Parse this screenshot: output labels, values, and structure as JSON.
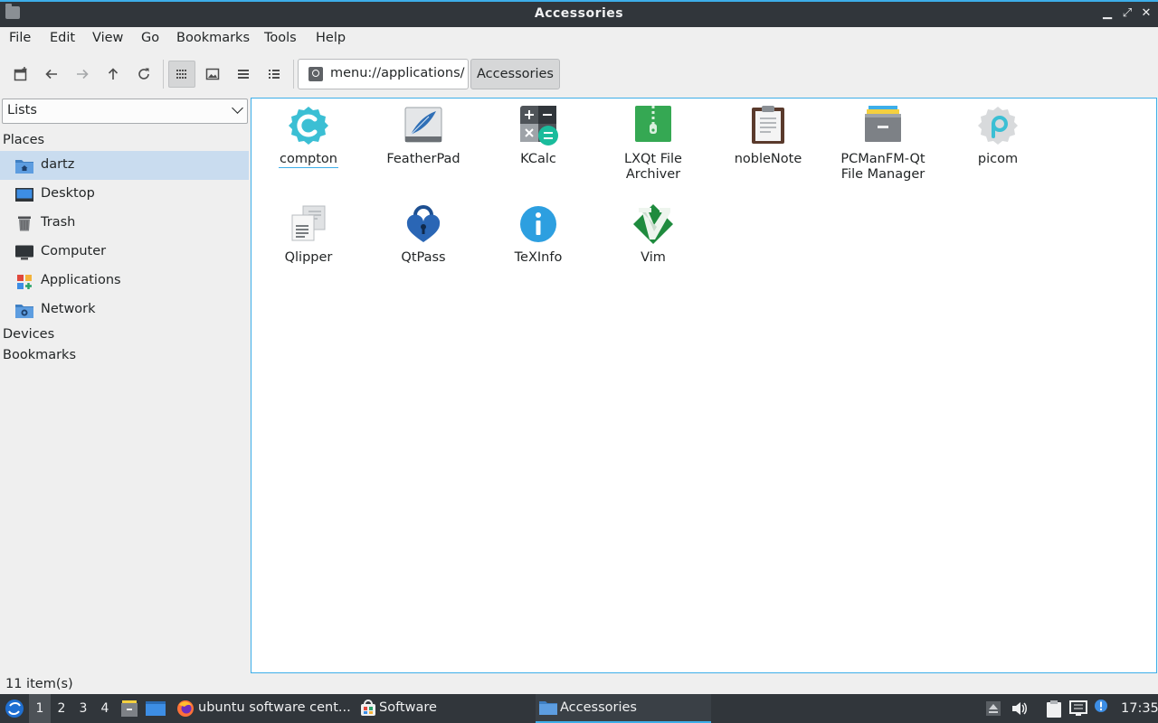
{
  "window": {
    "title": "Accessories"
  },
  "menubar": [
    "File",
    "Edit",
    "View",
    "Go",
    "Bookmarks",
    "Tools",
    "Help"
  ],
  "location": {
    "path": "menu://applications/",
    "breadcrumb": "Accessories"
  },
  "sidebar": {
    "selector": "Lists",
    "places_header": "Places",
    "places": [
      {
        "label": "dartz",
        "icon": "home-folder-icon",
        "selected": true
      },
      {
        "label": "Desktop",
        "icon": "desktop-icon",
        "selected": false
      },
      {
        "label": "Trash",
        "icon": "trash-icon",
        "selected": false
      },
      {
        "label": "Computer",
        "icon": "computer-icon",
        "selected": false
      },
      {
        "label": "Applications",
        "icon": "applications-icon",
        "selected": false
      },
      {
        "label": "Network",
        "icon": "network-folder-icon",
        "selected": false
      }
    ],
    "devices_header": "Devices",
    "bookmarks_header": "Bookmarks"
  },
  "files": [
    {
      "name": "compton",
      "icon": "compton-icon"
    },
    {
      "name": "FeatherPad",
      "icon": "featherpad-icon"
    },
    {
      "name": "KCalc",
      "icon": "kcalc-icon"
    },
    {
      "name": "LXQt File Archiver",
      "icon": "archiver-icon"
    },
    {
      "name": "nobleNote",
      "icon": "noblenote-icon"
    },
    {
      "name": "PCManFM-Qt File Manager",
      "icon": "file-manager-icon"
    },
    {
      "name": "picom",
      "icon": "picom-icon"
    },
    {
      "name": "Qlipper",
      "icon": "qlipper-icon"
    },
    {
      "name": "QtPass",
      "icon": "qtpass-icon"
    },
    {
      "name": "TeXInfo",
      "icon": "texinfo-icon"
    },
    {
      "name": "Vim",
      "icon": "vim-icon"
    }
  ],
  "status": {
    "text": "11 item(s)"
  },
  "taskbar": {
    "desktops": [
      "1",
      "2",
      "3",
      "4"
    ],
    "tasks": [
      {
        "label": "ubuntu software cent...",
        "icon": "firefox-icon"
      },
      {
        "label": "Software",
        "icon": "software-store-icon"
      },
      {
        "label": "Accessories",
        "icon": "folder-icon"
      }
    ],
    "clock": "17:35"
  },
  "colors": {
    "accent": "#3daee9",
    "titlebar": "#31363b",
    "selection": "#c9dcef"
  }
}
